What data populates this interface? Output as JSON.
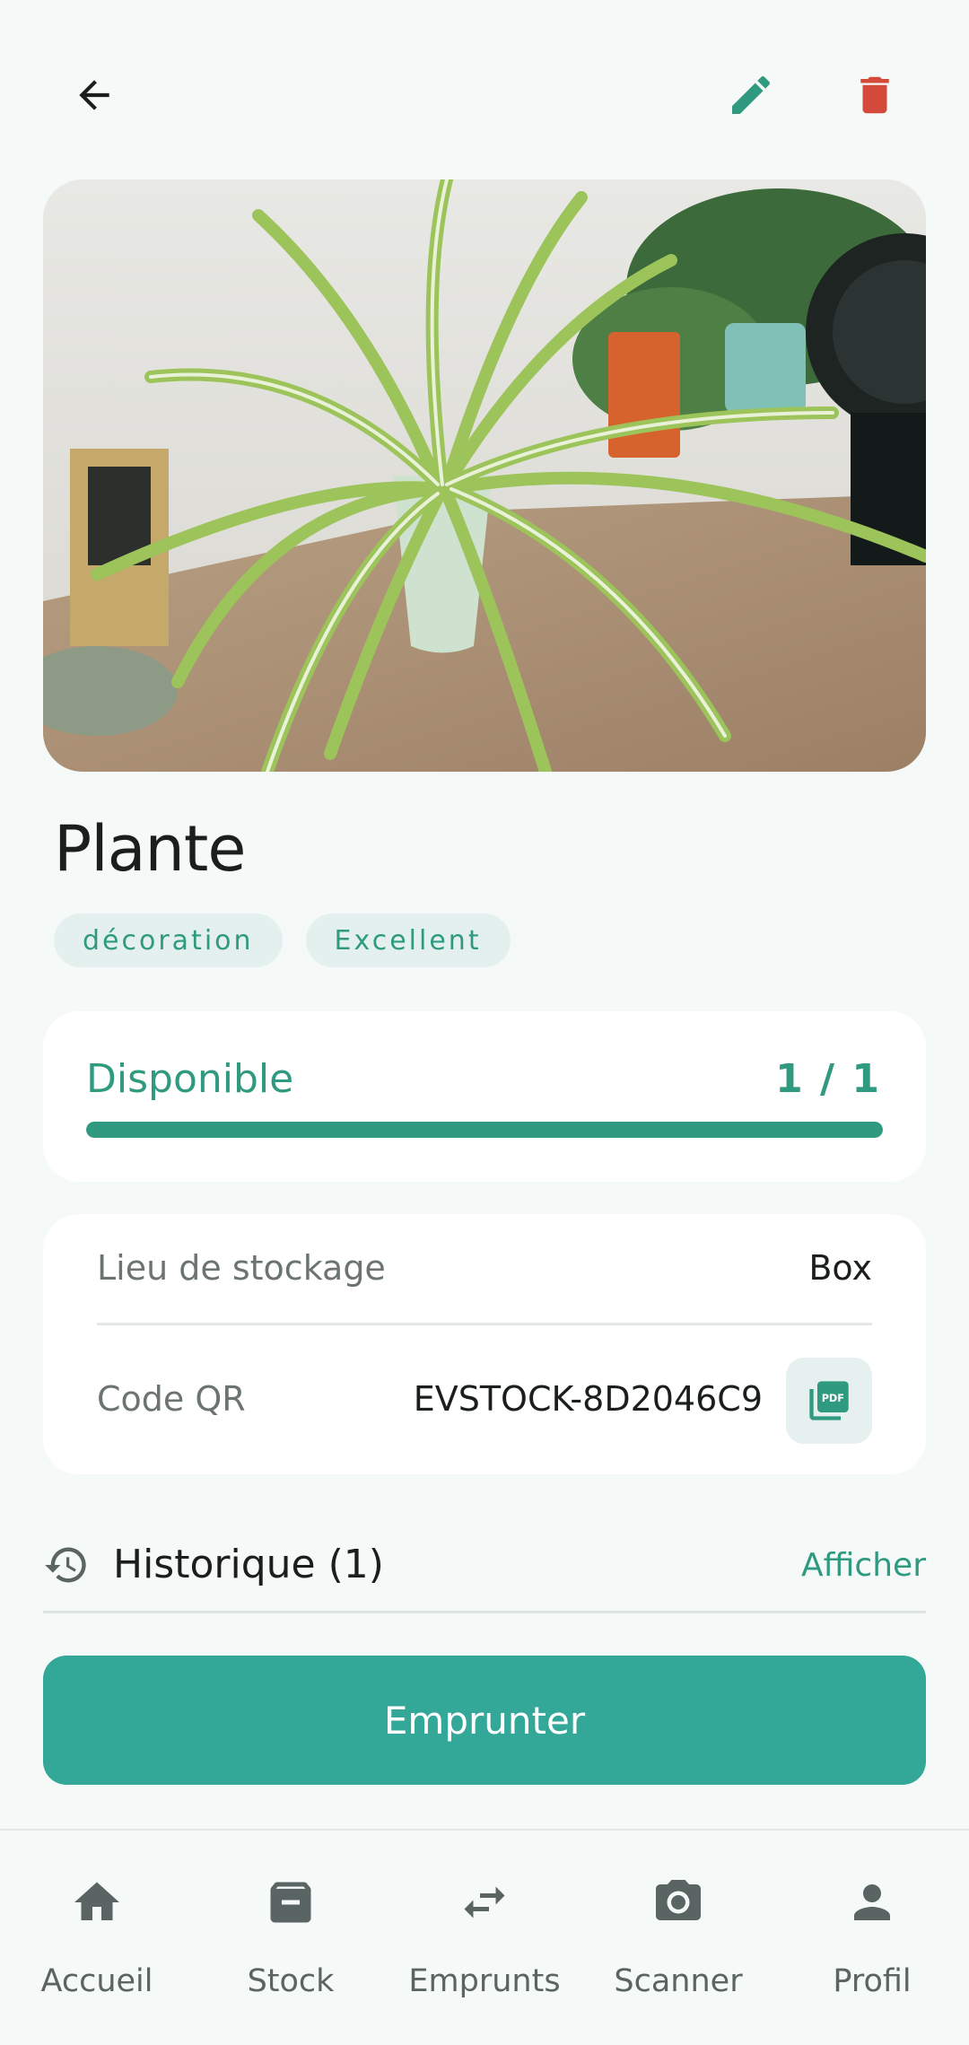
{
  "header": {
    "back_icon": "arrow-back-icon",
    "edit_icon": "pencil-icon",
    "delete_icon": "trash-icon",
    "colors": {
      "edit": "#2f9a7f",
      "delete": "#d44a3a"
    }
  },
  "item": {
    "title": "Plante",
    "tags": [
      "décoration",
      "Excellent"
    ]
  },
  "availability": {
    "label": "Disponible",
    "count": "1 / 1",
    "progress": 1.0,
    "color": "#2f9a7f"
  },
  "details": {
    "storage_label": "Lieu de stockage",
    "storage_value": "Box",
    "qr_label": "Code QR",
    "qr_value": "EVSTOCK-8D2046C9",
    "pdf_icon": "pdf-icon"
  },
  "history": {
    "title": "Historique (1)",
    "action": "Afficher",
    "icon": "history-icon"
  },
  "primary_action": {
    "label": "Emprunter",
    "color": "#33a899"
  },
  "bottom_nav": {
    "items": [
      {
        "label": "Accueil",
        "icon": "home-icon"
      },
      {
        "label": "Stock",
        "icon": "archive-box-icon"
      },
      {
        "label": "Emprunts",
        "icon": "swap-arrows-icon"
      },
      {
        "label": "Scanner",
        "icon": "camera-icon"
      },
      {
        "label": "Profil",
        "icon": "person-icon"
      }
    ]
  }
}
